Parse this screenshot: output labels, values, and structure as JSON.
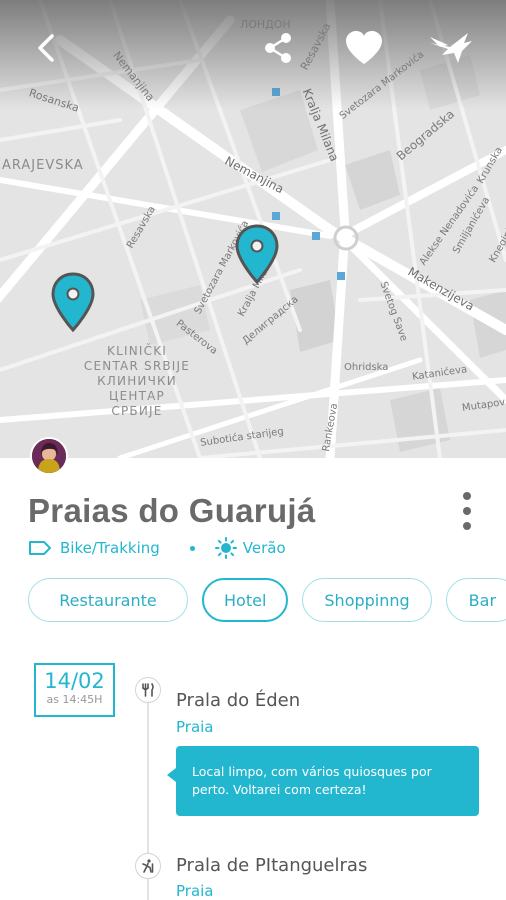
{
  "map": {
    "labels": {
      "nemanjina_top": "Nemanjina",
      "resavska_top": "Resavska",
      "svetozara_markovica_top": "Svetozara Markovića",
      "london_cyr": "ЛОНДОН",
      "rosanska": "Rosanska",
      "sarajevska": "ARAJEVSKA",
      "kralja_milana": "Kralja Milana",
      "beogradska": "Beogradska",
      "krunska": "Krunska",
      "nemanjina_mid": "Nemanjina",
      "resavska_mid": "Resavska",
      "svetozara_markovica_mid": "Svetozara Markovića",
      "kralja_milana_mid": "Kralja Milana",
      "aleksе_nenadovica": "Alekse Nenadovića",
      "smiljaniceva": "Smiljanićeva",
      "kneginje_z": "Kneginje Z.",
      "makenzijeva": "Makenzijeva",
      "svetog_save": "Svetog Save",
      "pasterova": "Pasterova",
      "deligradska_cyr": "Делиградска",
      "ohridska": "Ohridska",
      "katanićeva": "Katanićeva",
      "mutapova": "Mutapov",
      "district": [
        "KLINIČKI",
        "CENTAR SRBIJE",
        "КЛИНИЧКИ",
        "ЦЕНТАР",
        "СРБИЈЕ"
      ],
      "subotica": "Subotića starijeg",
      "rankeova": "Rankeova"
    }
  },
  "header": {
    "back_icon": "chevron-left-icon",
    "share_icon": "share-icon",
    "favorite_icon": "heart-icon",
    "send_icon": "bird-icon"
  },
  "place": {
    "title": "Praias do Guarujá",
    "category": "Bike/Trakking",
    "season": "Verão"
  },
  "filters": [
    "Restaurante",
    "Hotel",
    "Shoppinng",
    "Bar"
  ],
  "timeline": {
    "date": "14/02",
    "time": "as 14:45H",
    "entries": [
      {
        "name": "Prala do Éden",
        "type": "Praia",
        "icon": "fork-knife-icon",
        "note": "Local limpo, com vários quiosques por perto. Voltarei com certeza!"
      },
      {
        "name": "Prala de PItanguelras",
        "type": "Praia",
        "icon": "hiking-icon"
      }
    ]
  },
  "colors": {
    "accent": "#22b7cf",
    "title": "#6a6a6a",
    "map_bg": "#e6e6e6"
  }
}
